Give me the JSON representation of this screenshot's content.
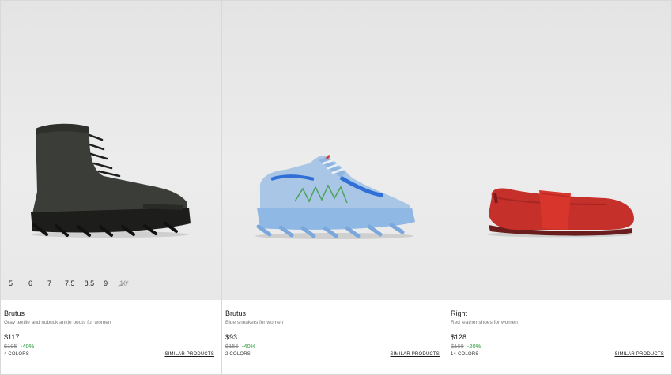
{
  "products": [
    {
      "name": "Brutus",
      "description": "Gray textile and nubuck ankle boots for women",
      "price": "$117",
      "old_price": "$195",
      "discount": "-40%",
      "colors": "4 COLORS",
      "similar_label": "SIMILAR PRODUCTS",
      "image_icon": "gray-ankle-boot",
      "sizes": [
        "5",
        "6",
        "7",
        "7.5",
        "8.5",
        "9",
        "10"
      ],
      "unavailable_size": "10"
    },
    {
      "name": "Brutus",
      "description": "Blue sneakers for women",
      "price": "$93",
      "old_price": "$155",
      "discount": "-40%",
      "colors": "2 COLORS",
      "similar_label": "SIMILAR PRODUCTS",
      "image_icon": "blue-sneaker"
    },
    {
      "name": "Right",
      "description": "Red leather shoes for women",
      "price": "$128",
      "old_price": "$160",
      "discount": "-20%",
      "colors": "14 COLORS",
      "similar_label": "SIMILAR PRODUCTS",
      "image_icon": "red-mary-jane-flat"
    }
  ],
  "colors": {
    "discount_green": "#2c9b3a",
    "image_background": "#e8e8e8"
  }
}
